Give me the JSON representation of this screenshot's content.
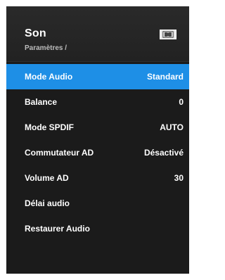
{
  "header": {
    "title": "Son",
    "breadcrumb": "Paramètres /",
    "icon": "dolby-icon"
  },
  "colors": {
    "panel_bg": "#1b1b1b",
    "selected_bg": "#1e8fe6",
    "text": "#ffffff"
  },
  "menu": {
    "items": [
      {
        "label": "Mode Audio",
        "value": "Standard",
        "selected": true
      },
      {
        "label": "Balance",
        "value": "0"
      },
      {
        "label": "Mode SPDIF",
        "value": "AUTO"
      },
      {
        "label": "Commutateur AD",
        "value": "Désactivé"
      },
      {
        "label": "Volume AD",
        "value": "30"
      },
      {
        "label": "Délai audio",
        "value": ""
      },
      {
        "label": "Restaurer Audio",
        "value": ""
      }
    ]
  }
}
